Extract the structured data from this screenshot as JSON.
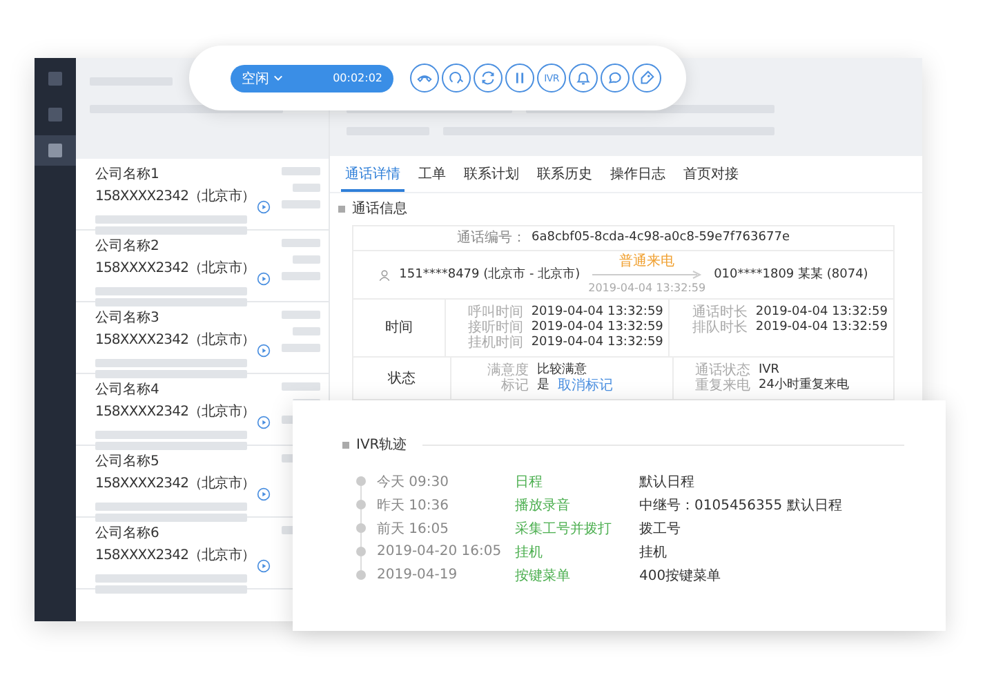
{
  "toolbar": {
    "status": "空闲",
    "timer": "00:02:02",
    "buttons": [
      {
        "kind": "hangup"
      },
      {
        "kind": "transfer"
      },
      {
        "kind": "refresh"
      },
      {
        "kind": "pause"
      },
      {
        "kind": "text",
        "label": "IVR"
      },
      {
        "kind": "bell"
      },
      {
        "kind": "chat"
      },
      {
        "kind": "tag"
      }
    ]
  },
  "sidebar": {
    "items": [
      {
        "selected": false
      },
      {
        "selected": false
      },
      {
        "selected": true
      }
    ]
  },
  "contacts": [
    {
      "name": "公司名称1",
      "phone": "158XXXX2342（北京市）"
    },
    {
      "name": "公司名称2",
      "phone": "158XXXX2342（北京市）"
    },
    {
      "name": "公司名称3",
      "phone": "158XXXX2342（北京市）"
    },
    {
      "name": "公司名称4",
      "phone": "158XXXX2342（北京市）"
    },
    {
      "name": "公司名称5",
      "phone": "158XXXX2342（北京市）"
    },
    {
      "name": "公司名称6",
      "phone": "158XXXX2342（北京市）"
    }
  ],
  "tabs": [
    {
      "label": "通话详情",
      "selected": true
    },
    {
      "label": "工单",
      "selected": false
    },
    {
      "label": "联系计划",
      "selected": false
    },
    {
      "label": "联系历史",
      "selected": false
    },
    {
      "label": "操作日志",
      "selected": false
    },
    {
      "label": "首页对接",
      "selected": false
    }
  ],
  "call_info": {
    "title": "通话信息",
    "call_id_label": "通话编号：",
    "call_id": "6a8cbf05-8cda-4c98-a0c8-59e7f763677e",
    "caller": "151****8479 (北京市 - 北京市)",
    "call_type": "普通来电",
    "call_time": "2019-04-04 13:32:59",
    "callee": "010****1809 某某 (8074)",
    "sections": [
      {
        "label": "时间",
        "left": [
          {
            "label": "呼叫时间",
            "value": "2019-04-04 13:32:59"
          },
          {
            "label": "接听时间",
            "value": "2019-04-04 13:32:59"
          },
          {
            "label": "挂机时间",
            "value": "2019-04-04 13:32:59"
          }
        ],
        "right": [
          {
            "label": "通话时长",
            "value": "2019-04-04 13:32:59"
          },
          {
            "label": "排队时长",
            "value": "2019-04-04 13:32:59"
          }
        ]
      },
      {
        "label": "状态",
        "left": [
          {
            "label": "满意度",
            "value": "比较满意"
          },
          {
            "label": "标记",
            "value": "是",
            "link": "取消标记"
          }
        ],
        "right": [
          {
            "label": "通话状态",
            "value": "IVR"
          },
          {
            "label": "重复来电",
            "value": "24小时重复来电"
          }
        ]
      }
    ]
  },
  "ivr": {
    "title": "IVR轨迹",
    "events": [
      {
        "time": "今天 09:30",
        "action": "日程",
        "detail": "默认日程"
      },
      {
        "time": "昨天 10:36",
        "action": "播放录音",
        "detail": "中继号：0105456355 默认日程"
      },
      {
        "time": "前天 16:05",
        "action": "采集工号并拨打",
        "detail": "拨工号"
      },
      {
        "time": "2019-04-20 16:05",
        "action": "挂机",
        "detail": "挂机"
      },
      {
        "time": "2019-04-19",
        "action": "按键菜单",
        "detail": "400按键菜单"
      }
    ]
  }
}
